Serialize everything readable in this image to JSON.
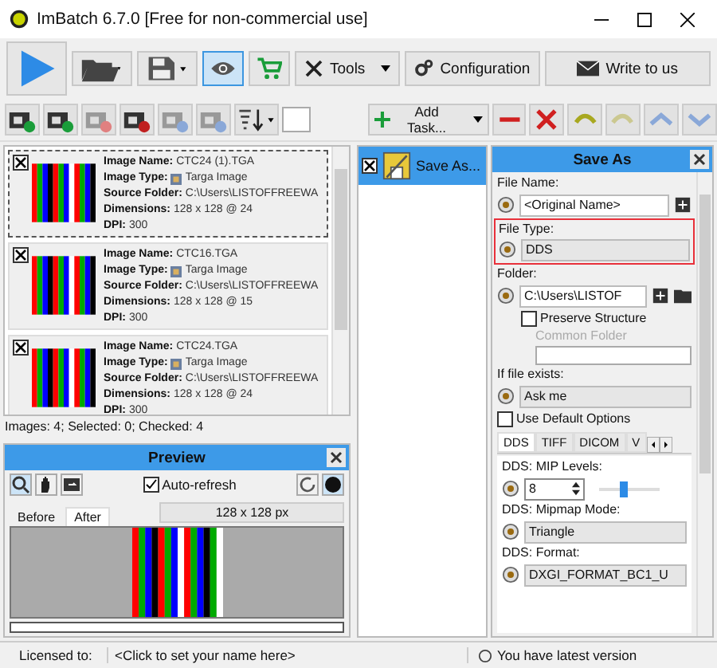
{
  "window": {
    "title": "ImBatch 6.7.0 [Free for non-commercial use]"
  },
  "toolbar": {
    "preview_on": true,
    "tools_label": "Tools",
    "configuration_label": "Configuration",
    "write_label": "Write to us"
  },
  "task_toolbar": {
    "add_task_label": "Add Task..."
  },
  "images": [
    {
      "checked": true,
      "focused": true,
      "fields": [
        {
          "label": "Image Name:",
          "value": "CTC24 (1).TGA"
        },
        {
          "label": "Image Type:",
          "value": "Targa Image"
        },
        {
          "label": "Source Folder:",
          "value": "C:\\Users\\LISTOFFREEWA"
        },
        {
          "label": "Dimensions:",
          "value": "128 x 128 @ 24"
        },
        {
          "label": "DPI:",
          "value": "300"
        }
      ]
    },
    {
      "checked": true,
      "focused": false,
      "fields": [
        {
          "label": "Image Name:",
          "value": "CTC16.TGA"
        },
        {
          "label": "Image Type:",
          "value": "Targa Image"
        },
        {
          "label": "Source Folder:",
          "value": "C:\\Users\\LISTOFFREEWA"
        },
        {
          "label": "Dimensions:",
          "value": "128 x 128 @ 15"
        },
        {
          "label": "DPI:",
          "value": "300"
        }
      ]
    },
    {
      "checked": true,
      "focused": false,
      "fields": [
        {
          "label": "Image Name:",
          "value": "CTC24.TGA"
        },
        {
          "label": "Image Type:",
          "value": "Targa Image"
        },
        {
          "label": "Source Folder:",
          "value": "C:\\Users\\LISTOFFREEWA"
        },
        {
          "label": "Dimensions:",
          "value": "128 x 128 @ 24"
        },
        {
          "label": "DPI:",
          "value": "300"
        }
      ]
    }
  ],
  "image_status": "Images: 4; Selected: 0; Checked: 4",
  "preview": {
    "title": "Preview",
    "auto_refresh": {
      "label": "Auto-refresh",
      "checked": true
    },
    "tabs": [
      {
        "label": "Before",
        "selected": false
      },
      {
        "label": "After",
        "selected": true
      }
    ],
    "size": "128 x 128 px"
  },
  "tasks": [
    {
      "label": "Save As...",
      "checked": true,
      "selected": true
    }
  ],
  "save_as": {
    "title": "Save As",
    "file_name": {
      "label": "File Name:",
      "value": "<Original Name>"
    },
    "file_type": {
      "label": "File Type:",
      "value": "DDS",
      "highlighted": true
    },
    "folder": {
      "label": "Folder:",
      "value": "C:\\Users\\LISTOF"
    },
    "preserve_structure": {
      "label": "Preserve Structure",
      "checked": false
    },
    "common_folder": {
      "label": "Common Folder",
      "disabled": true
    },
    "if_exists": {
      "label": "If file exists:",
      "value": "Ask me"
    },
    "use_default": {
      "label": "Use Default Options",
      "checked": false
    },
    "format_tabs": [
      {
        "label": "DDS",
        "selected": true
      },
      {
        "label": "TIFF",
        "selected": false
      },
      {
        "label": "DICOM",
        "selected": false
      },
      {
        "label": "V",
        "selected": false
      }
    ],
    "mip_levels": {
      "label": "DDS: MIP Levels:",
      "value": "8",
      "level": 0.4
    },
    "mipmap_mode": {
      "label": "DDS: Mipmap Mode:",
      "value": "Triangle"
    },
    "format": {
      "label": "DDS: Format:",
      "value": "DXGI_FORMAT_BC1_U"
    }
  },
  "status_bar": {
    "licensed_label": "Licensed to:",
    "licensed_value": "<Click to set your name here>",
    "version": "You have latest version"
  }
}
